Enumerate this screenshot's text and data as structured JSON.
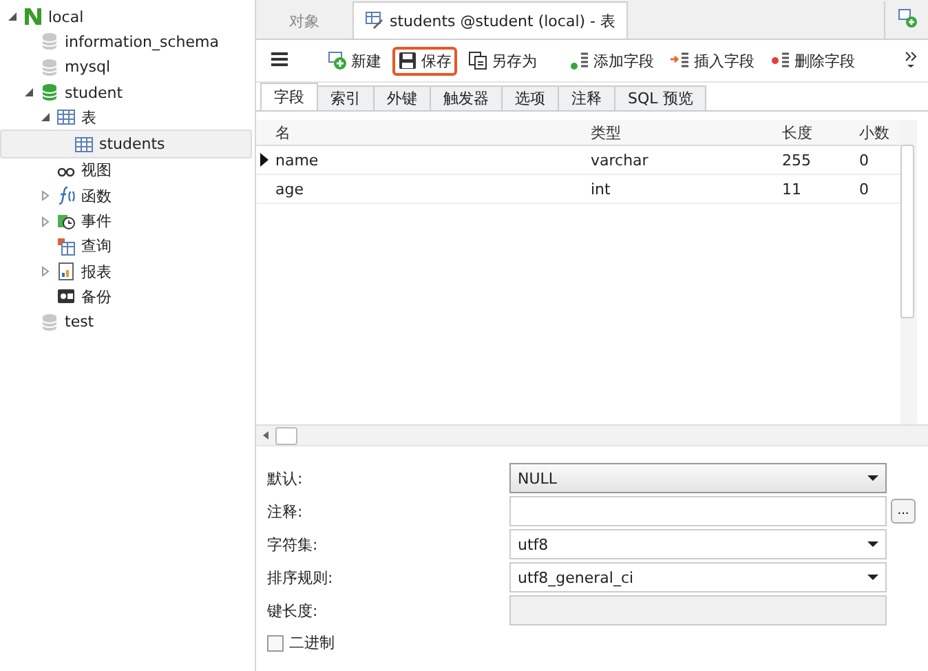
{
  "navigator": {
    "tree": [
      {
        "label": "local",
        "kind": "connection",
        "expanded": true,
        "selected": false,
        "children": [
          {
            "label": "information_schema",
            "kind": "database",
            "opened": false,
            "selected": false
          },
          {
            "label": "mysql",
            "kind": "database",
            "opened": false,
            "selected": false
          },
          {
            "label": "student",
            "kind": "database",
            "opened": true,
            "expanded": true,
            "selected": false,
            "children": [
              {
                "label": "表",
                "kind": "tables",
                "expanded": true,
                "selected": false,
                "children": [
                  {
                    "label": "students",
                    "kind": "table",
                    "selected": true
                  }
                ]
              },
              {
                "label": "视图",
                "kind": "view",
                "selected": false
              },
              {
                "label": "函数",
                "kind": "function",
                "expanded": false,
                "selected": false
              },
              {
                "label": "事件",
                "kind": "event",
                "expanded": false,
                "selected": false
              },
              {
                "label": "查询",
                "kind": "query",
                "selected": false
              },
              {
                "label": "报表",
                "kind": "report",
                "expanded": false,
                "selected": false
              },
              {
                "label": "备份",
                "kind": "backup",
                "selected": false
              }
            ]
          },
          {
            "label": "test",
            "kind": "database",
            "opened": false,
            "selected": false
          }
        ]
      }
    ]
  },
  "doc_tabs": [
    {
      "label": "对象",
      "selected": false
    },
    {
      "label": "students @student (local) - 表",
      "selected": true
    }
  ],
  "toolbar": [
    {
      "label": "新建",
      "kind": "new",
      "highlighted": false
    },
    {
      "label": "保存",
      "kind": "save",
      "highlighted": true
    },
    {
      "label": "另存为",
      "kind": "saveas",
      "highlighted": false
    },
    {
      "label": "添加字段",
      "kind": "add",
      "highlighted": false
    },
    {
      "label": "插入字段",
      "kind": "insert",
      "highlighted": false
    },
    {
      "label": "删除字段",
      "kind": "delete",
      "highlighted": false
    }
  ],
  "design_tabs": [
    {
      "label": "字段",
      "selected": true
    },
    {
      "label": "索引",
      "selected": false
    },
    {
      "label": "外键",
      "selected": false
    },
    {
      "label": "触发器",
      "selected": false
    },
    {
      "label": "选项",
      "selected": false
    },
    {
      "label": "注释",
      "selected": false
    },
    {
      "label": "SQL 预览",
      "selected": false
    }
  ],
  "table": {
    "columns": [
      "名",
      "类型",
      "长度",
      "小数"
    ],
    "rows": [
      {
        "cells": [
          "name",
          "varchar",
          "255",
          "0"
        ],
        "selected": true
      },
      {
        "cells": [
          "age",
          "int",
          "11",
          "0"
        ],
        "selected": false
      }
    ]
  },
  "properties": [
    {
      "label": "默认:",
      "kind": "select",
      "value": "NULL"
    },
    {
      "label": "注释:",
      "kind": "text",
      "button": "..."
    },
    {
      "label": "字符集:",
      "kind": "select",
      "value": "utf8"
    },
    {
      "label": "排序规则:",
      "kind": "select",
      "value": "utf8_general_ci"
    },
    {
      "label": "键长度:",
      "kind": "disabled"
    }
  ],
  "binary": {
    "label": "二进制",
    "checked": false
  }
}
